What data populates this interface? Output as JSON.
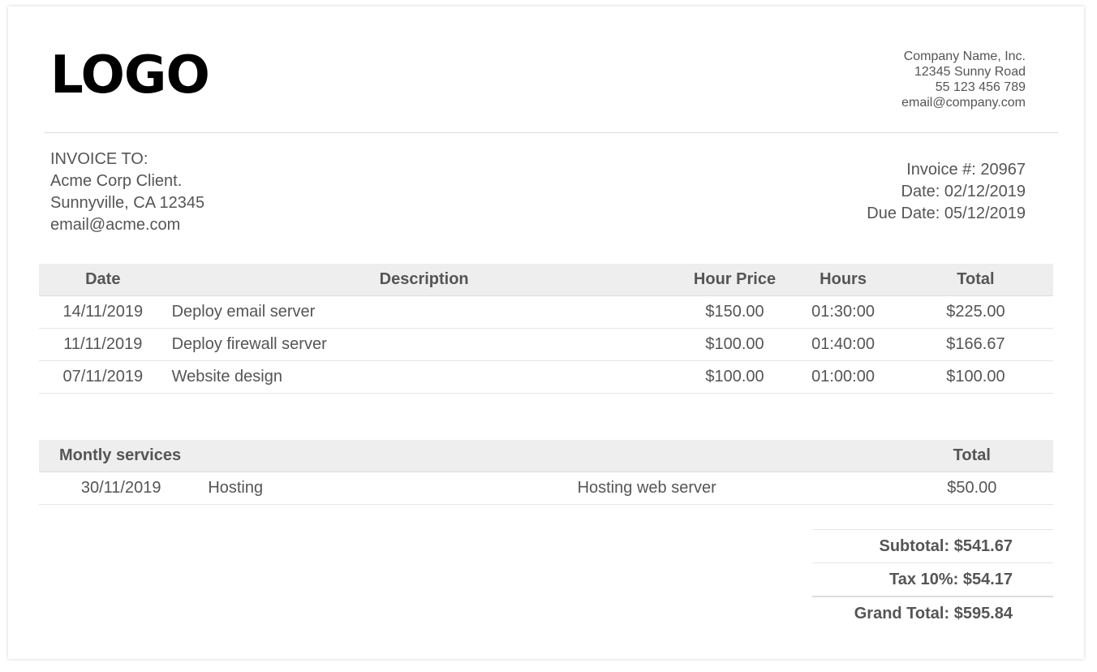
{
  "header": {
    "logo_text": "LOGO",
    "company": {
      "name": "Company Name, Inc.",
      "address": "12345 Sunny Road",
      "phone": "55 123 456 789",
      "email": "email@company.com"
    }
  },
  "bill_to": {
    "label": "INVOICE TO:",
    "client": "Acme Corp Client.",
    "city": "Sunnyville, CA 12345",
    "email": "email@acme.com"
  },
  "invoice": {
    "number": "Invoice #: 20967",
    "date": "Date: 02/12/2019",
    "due_date": "Due Date: 05/12/2019"
  },
  "items": {
    "headers": {
      "date": "Date",
      "description": "Description",
      "hour_price": "Hour Price",
      "hours": "Hours",
      "total": "Total"
    },
    "rows": [
      {
        "date": "14/11/2019",
        "description": "Deploy email server",
        "hour_price": "$150.00",
        "hours": "01:30:00",
        "total": "$225.00"
      },
      {
        "date": "11/11/2019",
        "description": "Deploy firewall server",
        "hour_price": "$100.00",
        "hours": "01:40:00",
        "total": "$166.67"
      },
      {
        "date": "07/11/2019",
        "description": "Website design",
        "hour_price": "$100.00",
        "hours": "01:00:00",
        "total": "$100.00"
      }
    ]
  },
  "monthly": {
    "header_label": "Montly services",
    "header_total": "Total",
    "rows": [
      {
        "date": "30/11/2019",
        "name": "Hosting",
        "description": "Hosting web server",
        "total": "$50.00"
      }
    ]
  },
  "totals": {
    "subtotal": "Subtotal: $541.67",
    "tax": "Tax 10%: $54.17",
    "grand_total": "Grand Total: $595.84"
  }
}
